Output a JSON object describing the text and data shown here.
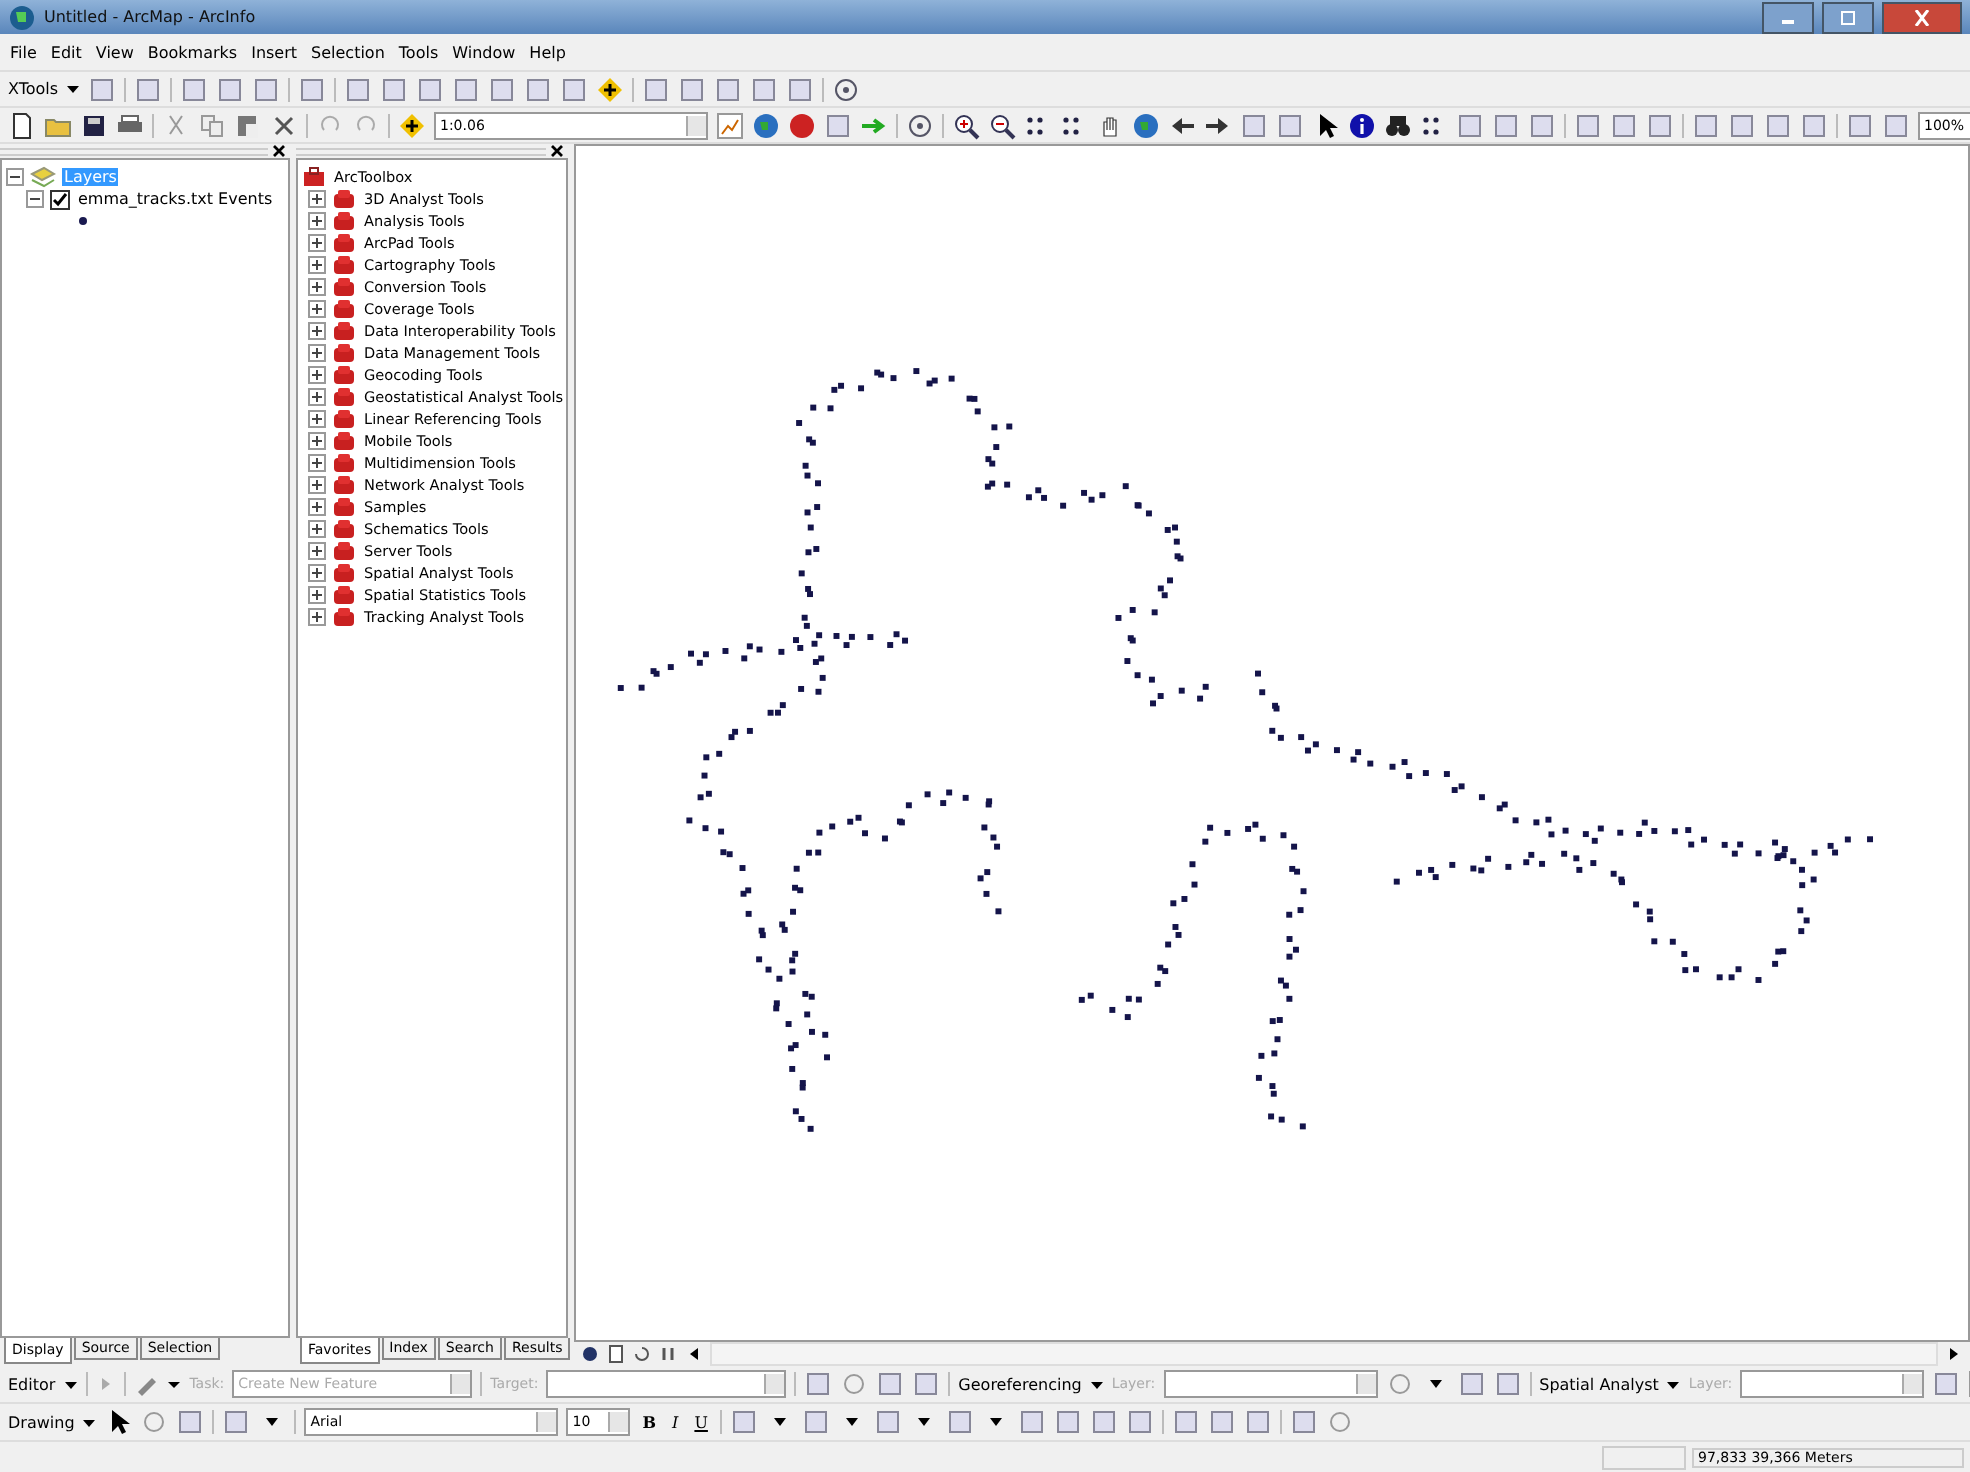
{
  "window": {
    "title": "Untitled - ArcMap - ArcInfo"
  },
  "menu": [
    "File",
    "Edit",
    "View",
    "Bookmarks",
    "Insert",
    "Selection",
    "Tools",
    "Window",
    "Help"
  ],
  "xtools_toolbar": {
    "label": "XTools"
  },
  "standard_toolbar": {
    "scale": "1:0.06",
    "layout_zoom": "100%"
  },
  "table_of_contents": {
    "root": {
      "label": "Layers",
      "selected": true,
      "expanded": true,
      "children": [
        {
          "label": "emma_tracks.txt Events",
          "checked": true,
          "expanded": true
        }
      ]
    },
    "tabs": [
      {
        "label": "Display",
        "selected": true
      },
      {
        "label": "Source",
        "selected": false
      },
      {
        "label": "Selection",
        "selected": false
      }
    ]
  },
  "toolbox": {
    "root": "ArcToolbox",
    "items": [
      {
        "label": "3D Analyst Tools",
        "expanded": false
      },
      {
        "label": "Analysis Tools",
        "expanded": false
      },
      {
        "label": "ArcPad Tools",
        "expanded": false
      },
      {
        "label": "Cartography Tools",
        "expanded": false
      },
      {
        "label": "Conversion Tools",
        "expanded": false
      },
      {
        "label": "Coverage Tools",
        "expanded": false
      },
      {
        "label": "Data Interoperability Tools",
        "expanded": false
      },
      {
        "label": "Data Management Tools",
        "expanded": false
      },
      {
        "label": "Geocoding Tools",
        "expanded": false
      },
      {
        "label": "Geostatistical Analyst Tools",
        "expanded": false
      },
      {
        "label": "Linear Referencing Tools",
        "expanded": false
      },
      {
        "label": "Mobile Tools",
        "expanded": false
      },
      {
        "label": "Multidimension Tools",
        "expanded": false
      },
      {
        "label": "Network Analyst Tools",
        "expanded": false
      },
      {
        "label": "Samples",
        "expanded": false
      },
      {
        "label": "Schematics Tools",
        "expanded": false
      },
      {
        "label": "Server Tools",
        "expanded": false
      },
      {
        "label": "Spatial Analyst Tools",
        "expanded": false
      },
      {
        "label": "Spatial Statistics Tools",
        "expanded": false
      },
      {
        "label": "Tracking Analyst Tools",
        "expanded": false
      }
    ],
    "tabs": [
      {
        "label": "Favorites",
        "selected": true
      },
      {
        "label": "Index",
        "selected": false
      },
      {
        "label": "Search",
        "selected": false
      },
      {
        "label": "Results",
        "selected": false
      }
    ]
  },
  "editor_toolbar": {
    "menu": "Editor",
    "task_label": "Task:",
    "task": "Create New Feature",
    "target_label": "Target:",
    "disabled": true
  },
  "georeferencing_toolbar": {
    "menu": "Georeferencing",
    "layer_label": "Layer:",
    "disabled": true
  },
  "spatial_analyst_toolbar": {
    "menu": "Spatial Analyst",
    "layer_label": "Layer:",
    "disabled": true
  },
  "drawing_toolbar": {
    "menu": "Drawing",
    "font": "Arial",
    "size": "10",
    "bold": "B",
    "italic": "I",
    "underline": "U"
  },
  "status_bar": {
    "coordinates": "97,833  39,366 Meters"
  }
}
